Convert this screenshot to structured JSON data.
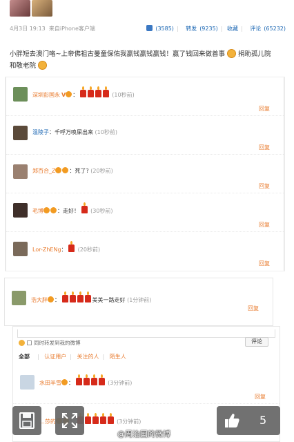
{
  "post": {
    "date": "4月3日 19:13",
    "source": "来自iPhone客户端",
    "likes": "(3585)",
    "reposts_label": "转发",
    "reposts": "(9235)",
    "favorite": "收藏",
    "comments_label": "评论",
    "comments": "(65232)",
    "text": "小胖短去澳门咯~上帝佛祖古曼童保佑我赢钱赢钱赢钱！赢了钱回来做善事",
    "text2": "捐助孤儿院",
    "text3": "和敬老院"
  },
  "comments_panel1": [
    {
      "user": "深圳彭国永",
      "badge": "V",
      "text": "",
      "time": "(10秒前)",
      "reply": "回复"
    },
    {
      "user": "温陵子",
      "text": "：千呼万唤屎出来",
      "time": "(10秒前)",
      "reply": "回复"
    },
    {
      "user": "郑百合_Z",
      "text": "：死了?",
      "time": "(20秒前)",
      "reply": "回复"
    },
    {
      "user": "毛博",
      "text": "：走好！",
      "time": "(30秒前)",
      "reply": "回复"
    },
    {
      "user": "Lor-ZhENg",
      "text": "：",
      "time": "(20秒前)",
      "reply": "回复"
    }
  ],
  "comment_panel2": {
    "user": "浩大胖",
    "text": "美美一路走好",
    "time": "(1分钟前)",
    "reply": "回复"
  },
  "compose": {
    "sync_label": "同时转发到我的微博",
    "submit": "评论",
    "filter_all": "全部",
    "filter_verified": "认证用户",
    "filter_following": "关注的人",
    "filter_stranger": "陌生人"
  },
  "comment_panel3": [
    {
      "user": "水田半雪",
      "text": "",
      "time": "(3分钟前)",
      "reply": "回复"
    },
    {
      "user": "…莎的",
      "text": "",
      "time": "(3分钟前)",
      "reply": ""
    }
  ],
  "toolbar": {
    "like_count": "5",
    "watermark": "@周治国的微博"
  }
}
